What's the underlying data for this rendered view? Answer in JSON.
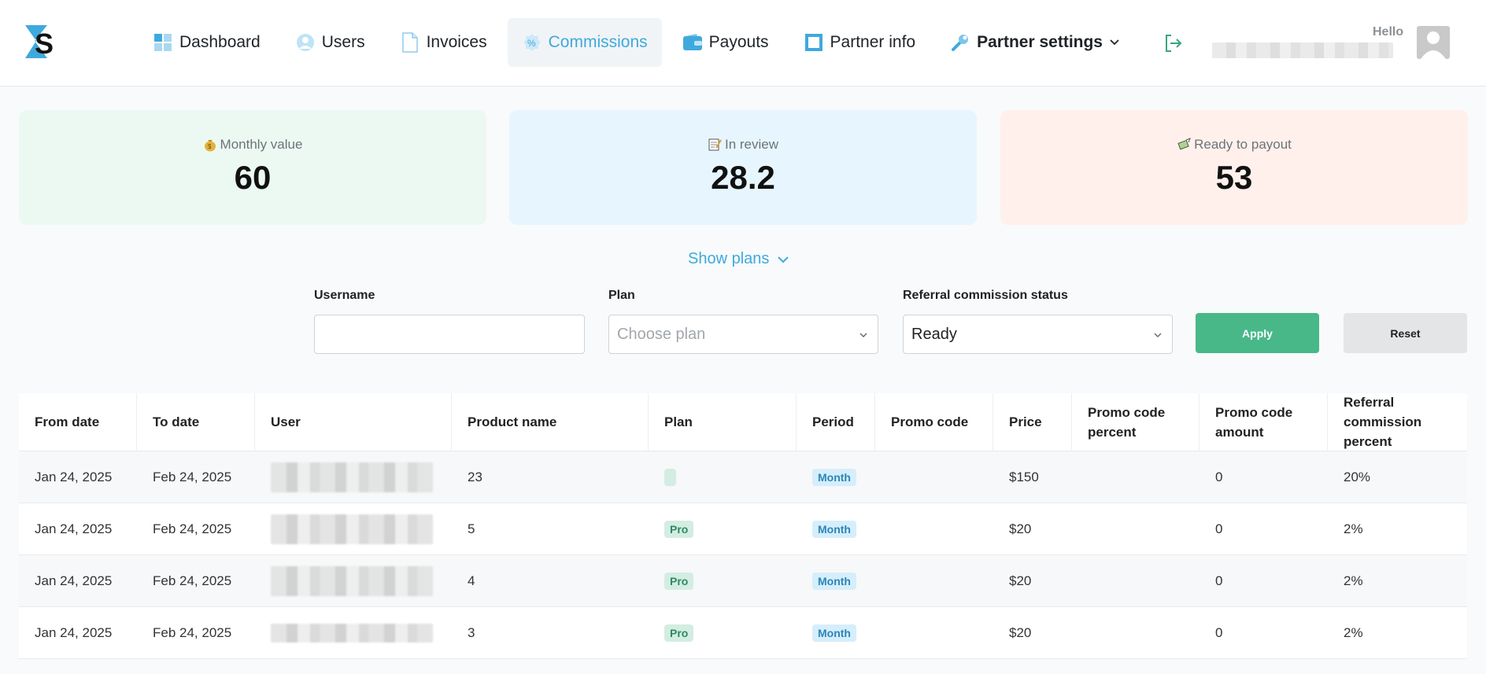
{
  "header": {
    "nav": [
      {
        "label": "Dashboard",
        "icon": "dashboard-icon"
      },
      {
        "label": "Users",
        "icon": "users-icon"
      },
      {
        "label": "Invoices",
        "icon": "invoice-icon"
      },
      {
        "label": "Commissions",
        "icon": "percent-icon",
        "active": true
      },
      {
        "label": "Payouts",
        "icon": "wallet-icon"
      },
      {
        "label": "Partner info",
        "icon": "info-square-icon"
      },
      {
        "label": "Partner settings",
        "icon": "wrench-icon"
      }
    ],
    "hello": "Hello"
  },
  "cards": {
    "monthly": {
      "label": "Monthly value",
      "value": "60"
    },
    "review": {
      "label": "In review",
      "value": "28.2"
    },
    "ready": {
      "label": "Ready to payout",
      "value": "53"
    }
  },
  "show_plans": "Show plans",
  "filters": {
    "username_label": "Username",
    "username_value": "",
    "plan_label": "Plan",
    "plan_placeholder": "Choose plan",
    "status_label": "Referral commission status",
    "status_value": "Ready",
    "apply": "Apply",
    "reset": "Reset"
  },
  "table": {
    "headers": [
      "From date",
      "To date",
      "User",
      "Product name",
      "Plan",
      "Period",
      "Promo code",
      "Price",
      "Promo code percent",
      "Promo code amount",
      "Referral commission percent"
    ],
    "rows": [
      {
        "from": "Jan 24, 2025",
        "to": "Feb 24, 2025",
        "product": "23",
        "plan": "",
        "period": "Month",
        "promo": "",
        "price": "$150",
        "promo_percent": "",
        "promo_amount": "0",
        "ref_percent": "20%"
      },
      {
        "from": "Jan 24, 2025",
        "to": "Feb 24, 2025",
        "product": "5",
        "plan": "Pro",
        "period": "Month",
        "promo": "",
        "price": "$20",
        "promo_percent": "",
        "promo_amount": "0",
        "ref_percent": "2%"
      },
      {
        "from": "Jan 24, 2025",
        "to": "Feb 24, 2025",
        "product": "4",
        "plan": "Pro",
        "period": "Month",
        "promo": "",
        "price": "$20",
        "promo_percent": "",
        "promo_amount": "0",
        "ref_percent": "2%"
      },
      {
        "from": "Jan 24, 2025",
        "to": "Feb 24, 2025",
        "product": "3",
        "plan": "Pro",
        "period": "Month",
        "promo": "",
        "price": "$20",
        "promo_percent": "",
        "promo_amount": "0",
        "ref_percent": "2%"
      }
    ]
  },
  "colors": {
    "accent": "#3fa9dd",
    "apply": "#48b889",
    "green_card": "#ecf9f3",
    "blue_card": "#e7f6fe",
    "red_card": "#fff0ec"
  }
}
